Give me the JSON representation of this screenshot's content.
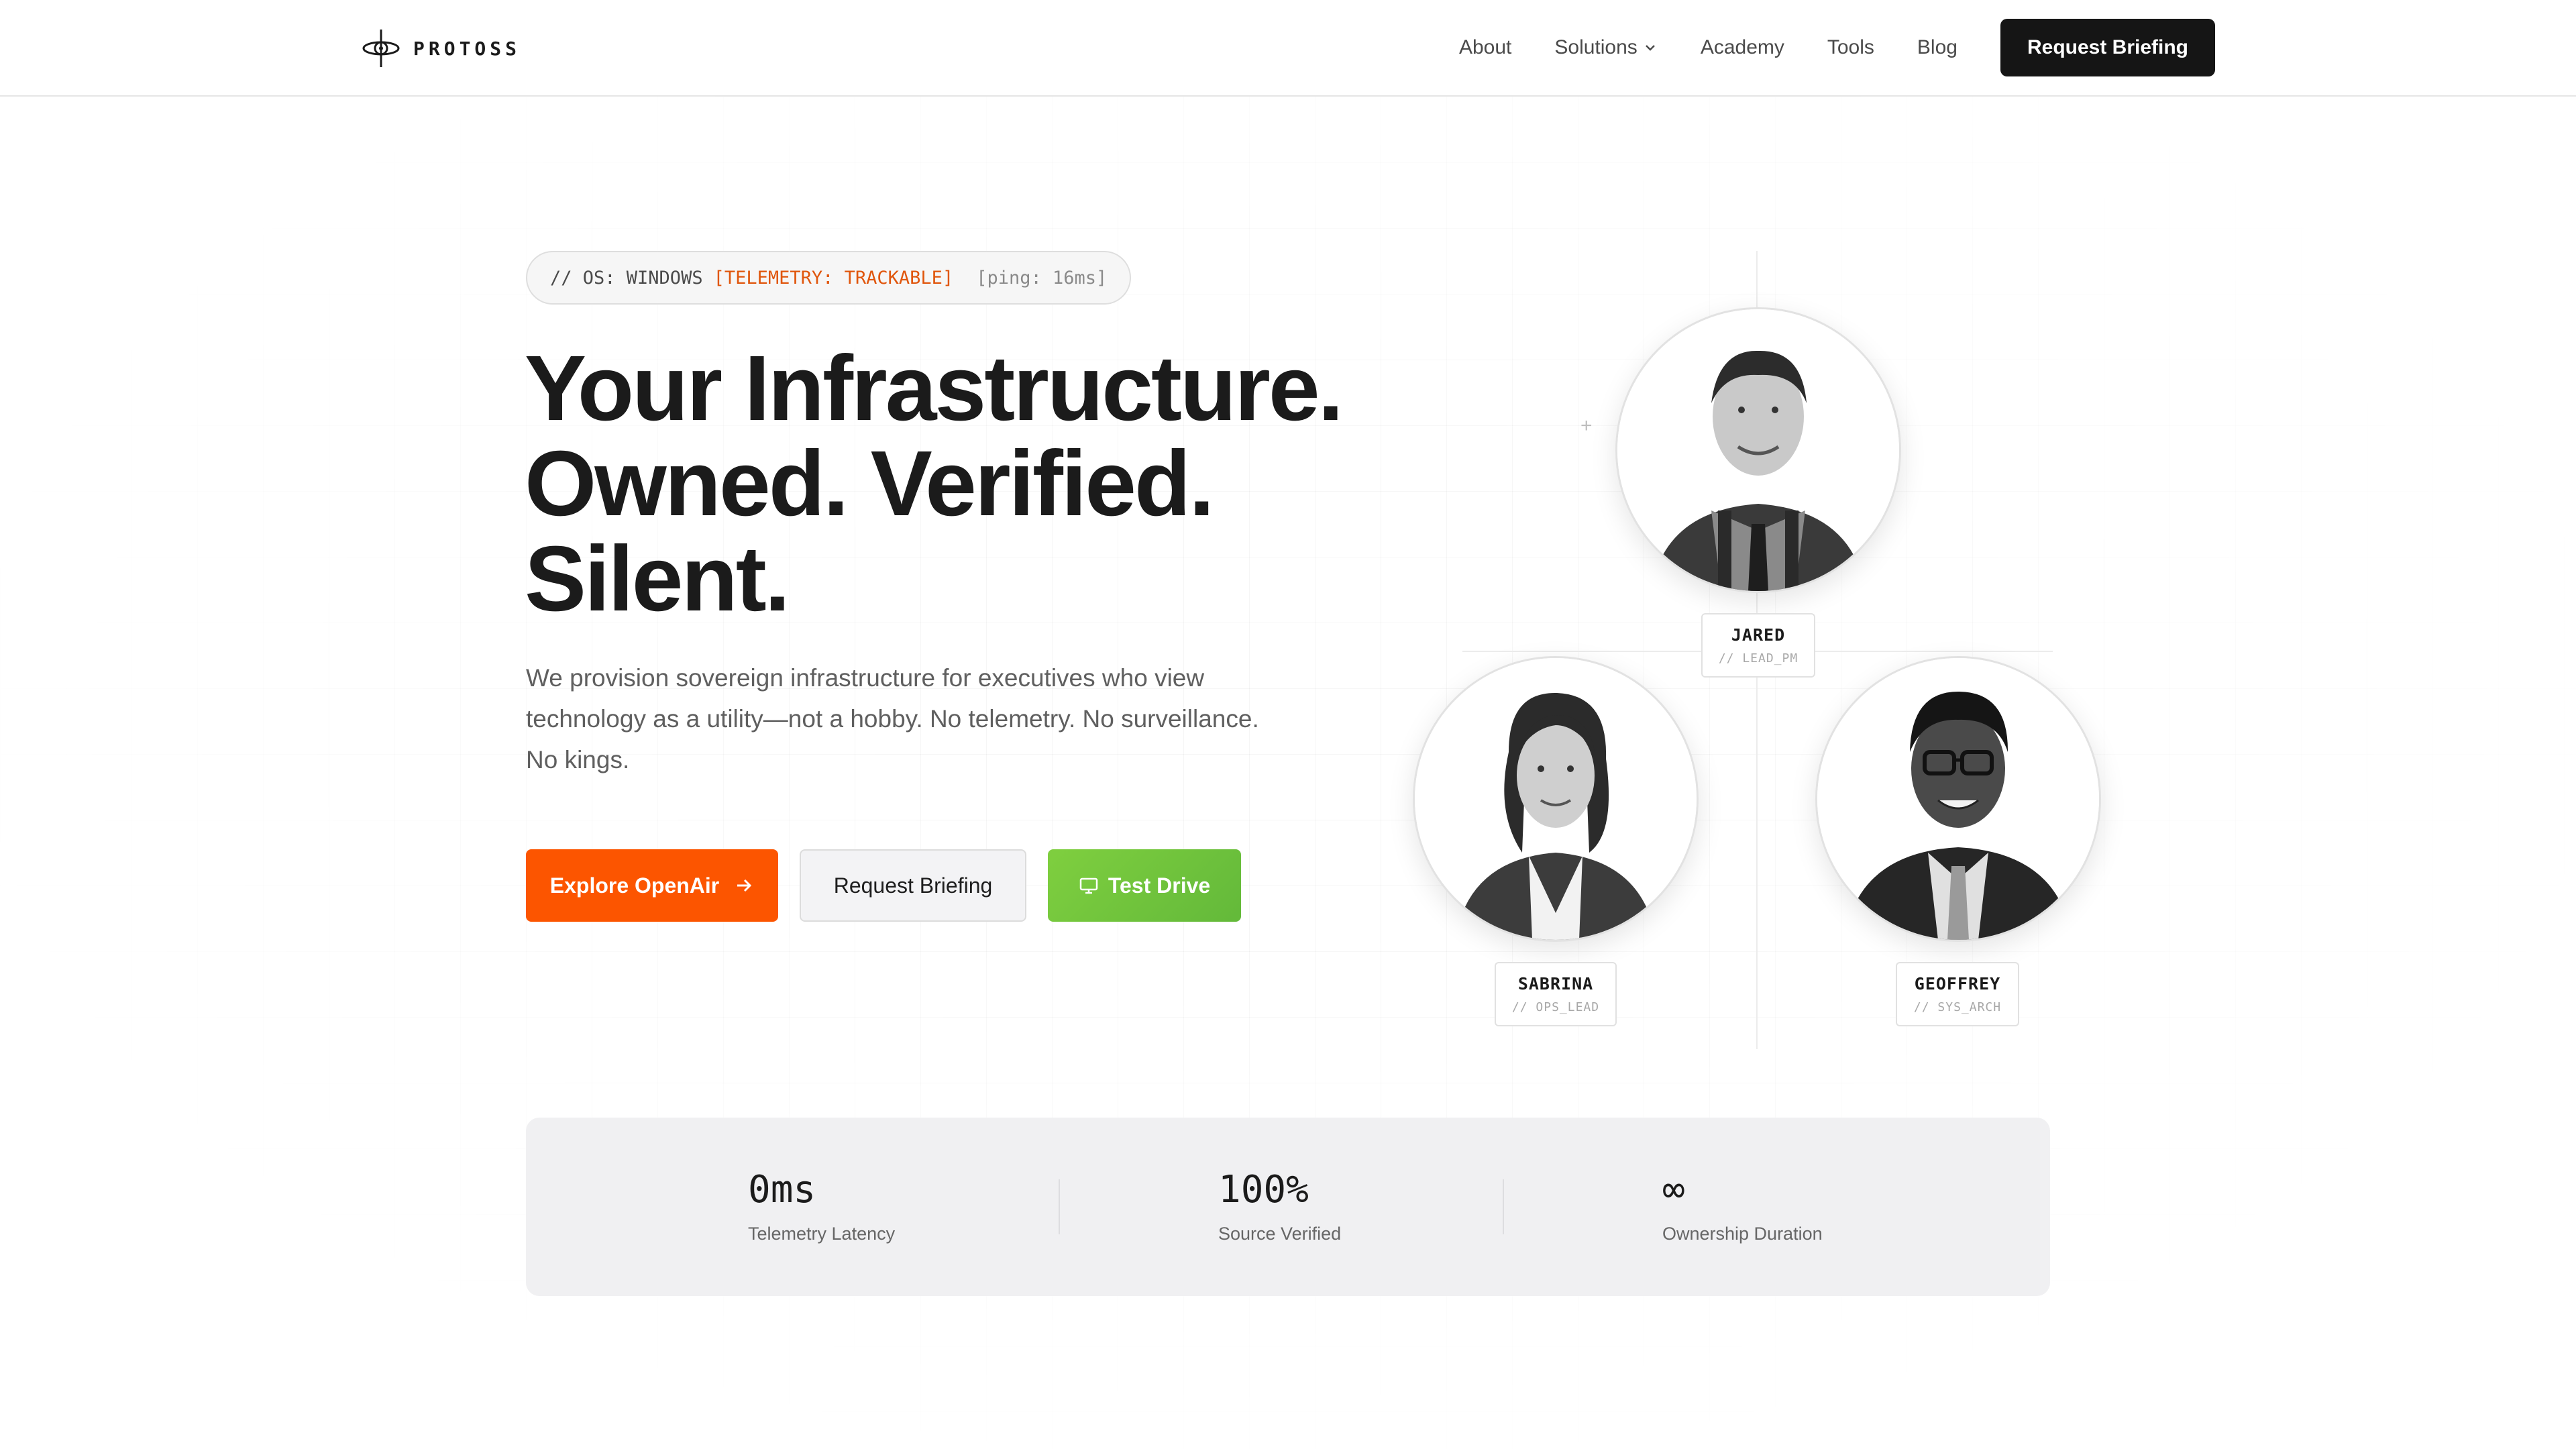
{
  "header": {
    "logo_text": "PROTOSS",
    "nav": [
      "About",
      "Solutions",
      "Academy",
      "Tools",
      "Blog"
    ],
    "cta_label": "Request Briefing"
  },
  "hero": {
    "status": {
      "os": "// OS: WINDOWS",
      "telemetry": "[TELEMETRY: TRACKABLE]",
      "ping": "[ping: 16ms]"
    },
    "headline": [
      "Your Infrastructure.",
      "Owned. Verified.",
      "Silent."
    ],
    "subcopy": "We provision sovereign infrastructure for executives who view technology as a utility—not a hobby. No telemetry. No surveillance. No kings.",
    "buttons": {
      "primary": "Explore OpenAir",
      "secondary": "Request Briefing",
      "tertiary": "Test Drive"
    },
    "colors": {
      "primary": "#fc5500",
      "tertiary": "#6cc23c",
      "nav_cta": "#151515"
    }
  },
  "team": [
    {
      "name": "JARED",
      "role": "// LEAD_PM"
    },
    {
      "name": "SABRINA",
      "role": "// OPS_LEAD"
    },
    {
      "name": "GEOFFREY",
      "role": "// SYS_ARCH"
    }
  ],
  "stats": [
    {
      "value": "0ms",
      "label": "Telemetry Latency"
    },
    {
      "value": "100%",
      "label": "Source Verified"
    },
    {
      "value": "∞",
      "label": "Ownership Duration"
    }
  ]
}
